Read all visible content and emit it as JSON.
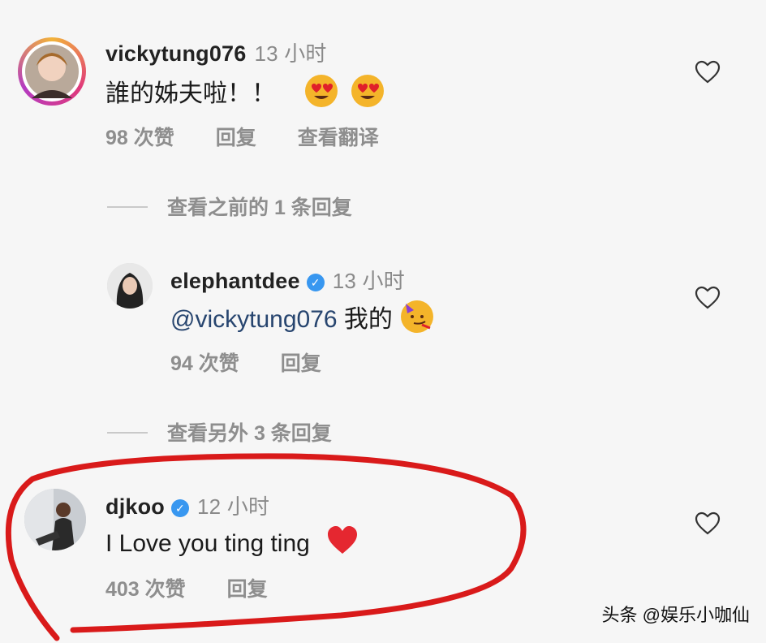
{
  "comments": [
    {
      "username": "vickytung076",
      "verified": false,
      "time": "13 小时",
      "text": "誰的姊夫啦！！",
      "emojis": [
        "heart-eyes",
        "heart-eyes"
      ],
      "likes": "98 次赞",
      "reply": "回复",
      "translate": "查看翻译"
    },
    {
      "username": "elephantdee",
      "verified": true,
      "time": "13 小时",
      "mention": "@vickytung076",
      "text": "我的",
      "emojis": [
        "partying-face"
      ],
      "likes": "94 次赞",
      "reply": "回复"
    },
    {
      "username": "djkoo",
      "verified": true,
      "time": "12 小时",
      "text": "I Love you ting ting",
      "emojis": [
        "red-heart"
      ],
      "likes": "403 次赞",
      "reply": "回复"
    }
  ],
  "view_previous": "查看之前的 1 条回复",
  "view_more": "查看另外 3 条回复",
  "watermark": "头条 @娱乐小咖仙",
  "colors": {
    "highlight": "#d91a1a",
    "verified": "#3897f0",
    "avatar_ring": "#c23cb0"
  }
}
